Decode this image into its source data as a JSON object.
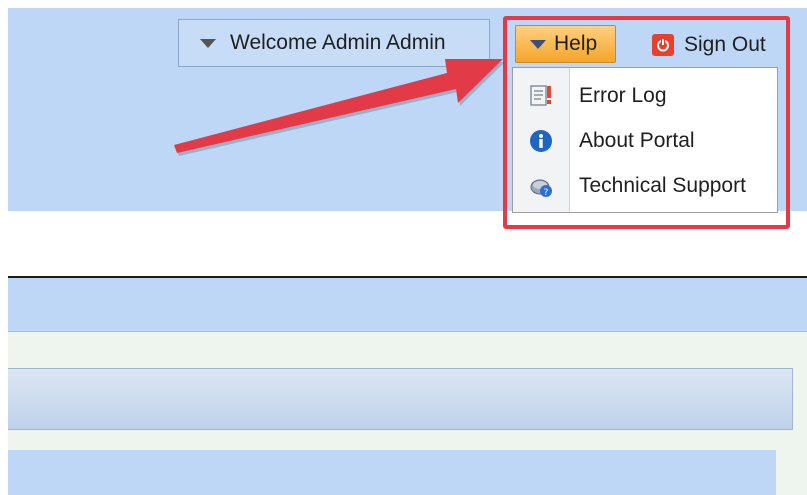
{
  "header": {
    "welcome_label": "Welcome Admin Admin",
    "help_label": "Help",
    "signout_label": "Sign Out"
  },
  "help_menu": {
    "items": [
      {
        "label": "Error Log",
        "icon": "error-log-icon"
      },
      {
        "label": "About Portal",
        "icon": "info-icon"
      },
      {
        "label": "Technical Support",
        "icon": "technical-support-icon"
      }
    ]
  },
  "colors": {
    "header_bg": "#bed7f7",
    "help_button": "#f5a52a",
    "annotation": "#e23b47",
    "signout_icon": "#e8402c"
  }
}
